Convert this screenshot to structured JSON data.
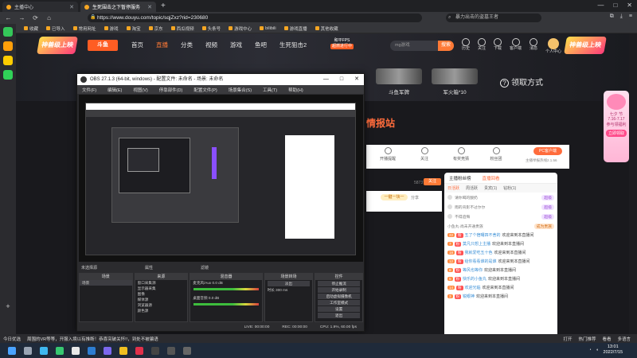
{
  "browser": {
    "tabs": [
      {
        "label": "主播中心",
        "active": false
      },
      {
        "label": "生死围击之下暂停服务",
        "active": true
      }
    ],
    "new_tab": "+",
    "window_controls": [
      "—",
      "□",
      "✕"
    ],
    "nav": {
      "back": "←",
      "forward": "→",
      "reload": "⟳",
      "home": "⌂"
    },
    "url": "https://www.douyu.com/topic/sqjZxz?rid=230680",
    "search_placeholder": "暴力出击的盗墓王者",
    "bookmarks": [
      "收藏",
      "已导入",
      "常用网址",
      "游戏",
      "淘宝",
      "京东",
      "西瓜视频",
      "头条号",
      "游戏中心",
      "bilibili",
      "游戏直播",
      "其他收藏"
    ]
  },
  "site": {
    "logo_left": "神兽级上映",
    "brand": "斗鱼",
    "nav": [
      {
        "label": "首页",
        "active": false
      },
      {
        "label": "直播",
        "active": true
      },
      {
        "label": "分类",
        "active": false
      },
      {
        "label": "视频",
        "active": false
      },
      {
        "label": "游戏",
        "active": false
      },
      {
        "label": "鱼吧",
        "active": false
      },
      {
        "label": "生死狙击2",
        "active": false
      }
    ],
    "pubg_line1": "和平FPS",
    "pubg_line2": "超燃进行中",
    "search_placeholder": "mg游戏",
    "search_button": "搜索",
    "user_icons": [
      "历史",
      "关注",
      "下载",
      "客户端",
      "消息",
      "个人中心"
    ],
    "logo_right": "神兽级上映"
  },
  "hero": {
    "items": [
      {
        "label": "斗鱼军牌"
      },
      {
        "label": "军火箱*10"
      }
    ],
    "learn_more": "领取方式"
  },
  "festival": {
    "title": "七夕 节",
    "dates": "7.16-7.17",
    "sub": "参与领福利",
    "button": "立即领取"
  },
  "intel": {
    "title": "情报站",
    "tools": [
      "开播提醒",
      "关注",
      "有奖竞猜",
      "粉丝团"
    ],
    "pc_client": "PC客户端",
    "report": "主播举报热线2.1.56",
    "score": "587377",
    "team_button": "一键一块一",
    "share": "分享",
    "follow": "关注"
  },
  "chat": {
    "header": [
      {
        "label": "主播粉丝榜",
        "active": false
      },
      {
        "label": "直播回看",
        "active": true
      }
    ],
    "tabs": [
      {
        "label": "日活跃",
        "active": true
      },
      {
        "label": "周活跃",
        "active": false
      },
      {
        "label": "贵宾(1)",
        "active": false
      },
      {
        "label": "钻粉(1)",
        "active": false
      }
    ],
    "hint": "小鱼丸·尚未开通贵族",
    "become_noble": "成为贵族",
    "nobles": [
      {
        "name": "请你喝的酸奶",
        "tag": "超级"
      },
      {
        "name": "雨的背影不过尔尔",
        "tag": "超级"
      },
      {
        "name": "不得追悔",
        "tag": "超级"
      }
    ],
    "messages": [
      {
        "lv": "22",
        "name": "五了个宿曙四不舍的",
        "text": "欢迎来到本直播间"
      },
      {
        "lv": "7",
        "name": "莫凡只想上主播",
        "text": "欢迎来到本直播间"
      },
      {
        "lv": "18",
        "name": "我就爱吃五十色",
        "text": "欢迎来到本直播间"
      },
      {
        "lv": "12",
        "name": "给你看看谁的是谁",
        "text": "欢迎来到本直播间"
      },
      {
        "lv": "8",
        "name": "等风也等你",
        "text": "欢迎来到本直播间"
      },
      {
        "lv": "5",
        "name": "快乐的小鱼丸",
        "text": "欢迎来到本直播间"
      },
      {
        "lv": "14",
        "name": "欢迎光临",
        "text": "欢迎来到本直播间"
      },
      {
        "lv": "3",
        "name": "锐眼神",
        "text": "欢迎来到本直播间"
      }
    ]
  },
  "obs": {
    "title": "OBS 27.1.3 (64-bit, windows) - 配置文件: 未命名 - 场景: 未命名",
    "window_controls": [
      "—",
      "□",
      "✕"
    ],
    "menu": [
      "文件(F)",
      "编辑(E)",
      "视图(V)",
      "停靠部件(D)",
      "配置文件(P)",
      "场景集合(S)",
      "工具(T)",
      "帮助(H)"
    ],
    "status_left": "未选择源",
    "status_props": "属性",
    "status_filters": "滤镜",
    "docks": {
      "scenes": {
        "title": "场景",
        "items": [
          "场景"
        ]
      },
      "sources": {
        "title": "来源",
        "items": [
          "窗口采集源",
          "显示器采集",
          "图像",
          "媒体源",
          "浏览器源",
          "颜色源"
        ]
      },
      "mixer": {
        "title": "混音器",
        "items": [
          "麦克风/Aux",
          "桌面音频"
        ],
        "levels": [
          "0.0 dB",
          "0.0 dB"
        ]
      },
      "transitions": {
        "title": "场景转场",
        "type": "淡出",
        "duration_label": "时长",
        "duration": "300 ms"
      },
      "controls": {
        "title": "控件",
        "buttons": [
          "停止推流",
          "开始录制",
          "启动虚拟摄像机",
          "工作室模式",
          "设置",
          "退出"
        ]
      }
    },
    "statusbar": {
      "live": "LIVE: 00:00:00",
      "rec": "REC: 00:00:00",
      "cpu": "CPU: 1.9%, 60.00 fps"
    }
  },
  "page_status": {
    "left": "今日优选",
    "ticker": "周围的VR等等，开服入境以有推断！恭喜突破关怀!!，到处不被骗语",
    "right": [
      "打开",
      "热门推荐",
      "看看",
      "多语言"
    ]
  },
  "taskbar": {
    "time": "13:01",
    "date": "2022/7/15"
  }
}
